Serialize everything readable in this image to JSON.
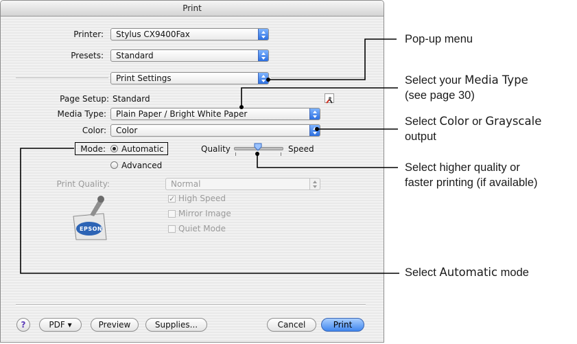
{
  "window": {
    "title": "Print"
  },
  "printer": {
    "label": "Printer:",
    "value": "Stylus CX9400Fax"
  },
  "presets": {
    "label": "Presets:",
    "value": "Standard"
  },
  "pane": {
    "value": "Print Settings"
  },
  "page_setup": {
    "label": "Page Setup:",
    "value": "Standard"
  },
  "media_type": {
    "label": "Media Type:",
    "value": "Plain Paper / Bright White Paper"
  },
  "color": {
    "label": "Color:",
    "value": "Color"
  },
  "mode": {
    "label": "Mode:",
    "automatic": "Automatic",
    "advanced": "Advanced",
    "selected": "Automatic"
  },
  "slider": {
    "left_label": "Quality",
    "right_label": "Speed"
  },
  "print_quality": {
    "label": "Print Quality:",
    "value": "Normal"
  },
  "options": {
    "high_speed": "High Speed",
    "mirror_image": "Mirror Image",
    "quiet_mode": "Quiet Mode"
  },
  "logo": {
    "text": "EPSON"
  },
  "footer": {
    "help": "?",
    "pdf": "PDF ▾",
    "preview": "Preview",
    "supplies": "Supplies...",
    "cancel": "Cancel",
    "print": "Print"
  },
  "callouts": {
    "popup_menu": "Pop-up menu",
    "media_line1_a": "Select your ",
    "media_line1_b": "Media Type",
    "media_line2": "(see page 30)",
    "color_line1_a": "Select ",
    "color_line1_b": "Color",
    "color_line1_c": " or ",
    "color_line1_d": "Grayscale",
    "color_line2": "output",
    "quality_line1": "Select higher quality or",
    "quality_line2": "faster printing (if available)",
    "auto_a": "Select ",
    "auto_b": "Automatic",
    "auto_c": " mode"
  }
}
